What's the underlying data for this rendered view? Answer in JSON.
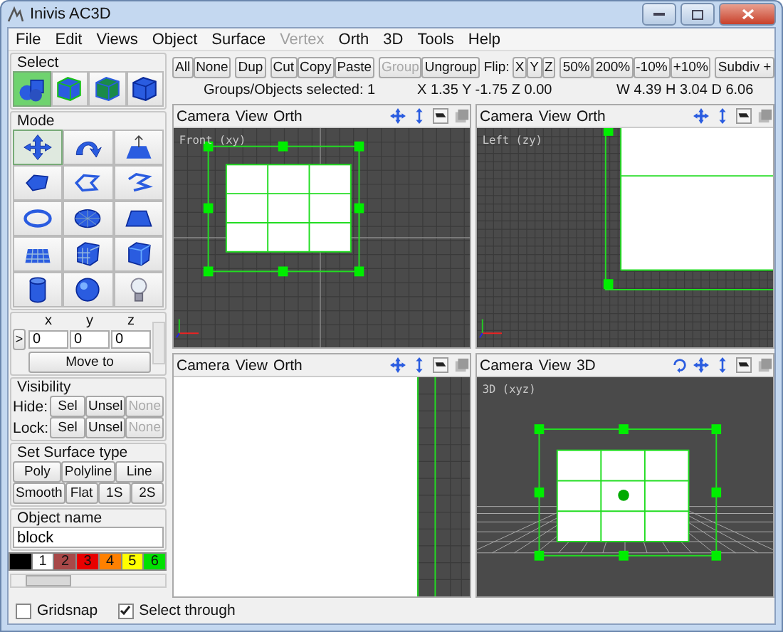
{
  "window": {
    "title": "Inivis AC3D"
  },
  "menu": [
    {
      "label": "File",
      "disabled": false
    },
    {
      "label": "Edit",
      "disabled": false
    },
    {
      "label": "Views",
      "disabled": false
    },
    {
      "label": "Object",
      "disabled": false
    },
    {
      "label": "Surface",
      "disabled": false
    },
    {
      "label": "Vertex",
      "disabled": true
    },
    {
      "label": "Orth",
      "disabled": false
    },
    {
      "label": "3D",
      "disabled": false
    },
    {
      "label": "Tools",
      "disabled": false
    },
    {
      "label": "Help",
      "disabled": false
    }
  ],
  "select_panel": {
    "title": "Select",
    "tools": [
      {
        "selected": true
      },
      {
        "selected": false
      },
      {
        "selected": false
      },
      {
        "selected": false
      }
    ]
  },
  "mode_panel": {
    "title": "Mode",
    "tools": [
      {
        "selected": true
      },
      {
        "selected": false
      },
      {
        "selected": false
      },
      {
        "selected": false
      },
      {
        "selected": false
      },
      {
        "selected": false
      },
      {
        "selected": false
      },
      {
        "selected": false
      },
      {
        "selected": false
      },
      {
        "selected": false
      },
      {
        "selected": false
      },
      {
        "selected": false
      },
      {
        "selected": false
      },
      {
        "selected": false
      },
      {
        "selected": false
      }
    ]
  },
  "coordinates": {
    "labels": [
      "x",
      "y",
      "z"
    ],
    "values": [
      "0",
      "0",
      "0"
    ],
    "toggle": ">",
    "button": "Move to"
  },
  "visibility": {
    "title": "Visibility",
    "rows": [
      {
        "label": "Hide:",
        "buttons": [
          {
            "label": "Sel",
            "disabled": false
          },
          {
            "label": "Unsel",
            "disabled": false
          },
          {
            "label": "None",
            "disabled": true
          }
        ]
      },
      {
        "label": "Lock:",
        "buttons": [
          {
            "label": "Sel",
            "disabled": false
          },
          {
            "label": "Unsel",
            "disabled": false
          },
          {
            "label": "None",
            "disabled": true
          }
        ]
      }
    ]
  },
  "surface_type": {
    "title": "Set Surface type",
    "rows": [
      {
        "buttons": [
          "Poly",
          "Polyline",
          "Line"
        ]
      },
      {
        "buttons": [
          "Smooth",
          "Flat",
          "1S",
          "2S"
        ]
      }
    ]
  },
  "object_name": {
    "title": "Object name",
    "value": "block"
  },
  "palette": [
    {
      "color": "#000000"
    },
    {
      "label": "1",
      "color": "#ffffff"
    },
    {
      "label": "2",
      "color": "#a84848"
    },
    {
      "label": "3",
      "color": "#e80000"
    },
    {
      "label": "4",
      "color": "#ff8000"
    },
    {
      "label": "5",
      "color": "#ffff00"
    },
    {
      "label": "6",
      "color": "#00e000"
    }
  ],
  "toolbar_groups": [
    {
      "buttons": [
        {
          "label": "All",
          "disabled": false
        },
        {
          "label": "None",
          "disabled": false
        }
      ]
    },
    {
      "buttons": [
        {
          "label": "Dup",
          "disabled": false
        }
      ]
    },
    {
      "buttons": [
        {
          "label": "Cut",
          "disabled": false
        },
        {
          "label": "Copy",
          "disabled": false
        },
        {
          "label": "Paste",
          "disabled": false
        }
      ]
    },
    {
      "buttons": [
        {
          "label": "Group",
          "disabled": true
        },
        {
          "label": "Ungroup",
          "disabled": false
        }
      ]
    },
    {
      "caption": "Flip:",
      "buttons": [
        {
          "label": "X",
          "disabled": false
        },
        {
          "label": "Y",
          "disabled": false
        },
        {
          "label": "Z",
          "disabled": false
        }
      ]
    },
    {
      "buttons": [
        {
          "label": "50%",
          "disabled": false
        },
        {
          "label": "200%",
          "disabled": false
        },
        {
          "label": "-10%",
          "disabled": false
        },
        {
          "label": "+10%",
          "disabled": false
        }
      ]
    },
    {
      "buttons": [
        {
          "label": "Subdiv +",
          "disabled": false
        }
      ]
    }
  ],
  "status": {
    "selection": "Groups/Objects selected: 1",
    "position": "X 1.35 Y -1.75 Z 0.00",
    "size": "W 4.39 H 3.04 D 6.06"
  },
  "viewports": [
    {
      "kind": "front",
      "menus": [
        "Camera",
        "View",
        "Orth"
      ],
      "label": "Front (xy)"
    },
    {
      "kind": "left",
      "menus": [
        "Camera",
        "View",
        "Orth"
      ],
      "label": "Left (zy)"
    },
    {
      "kind": "blank",
      "menus": [
        "Camera",
        "View",
        "Orth"
      ]
    },
    {
      "kind": "perspective",
      "menus": [
        "Camera",
        "View",
        "3D"
      ],
      "label": "3D (xyz)"
    }
  ],
  "options": [
    {
      "label": "Gridsnap",
      "checked": false
    },
    {
      "label": "Select through",
      "checked": true
    }
  ]
}
